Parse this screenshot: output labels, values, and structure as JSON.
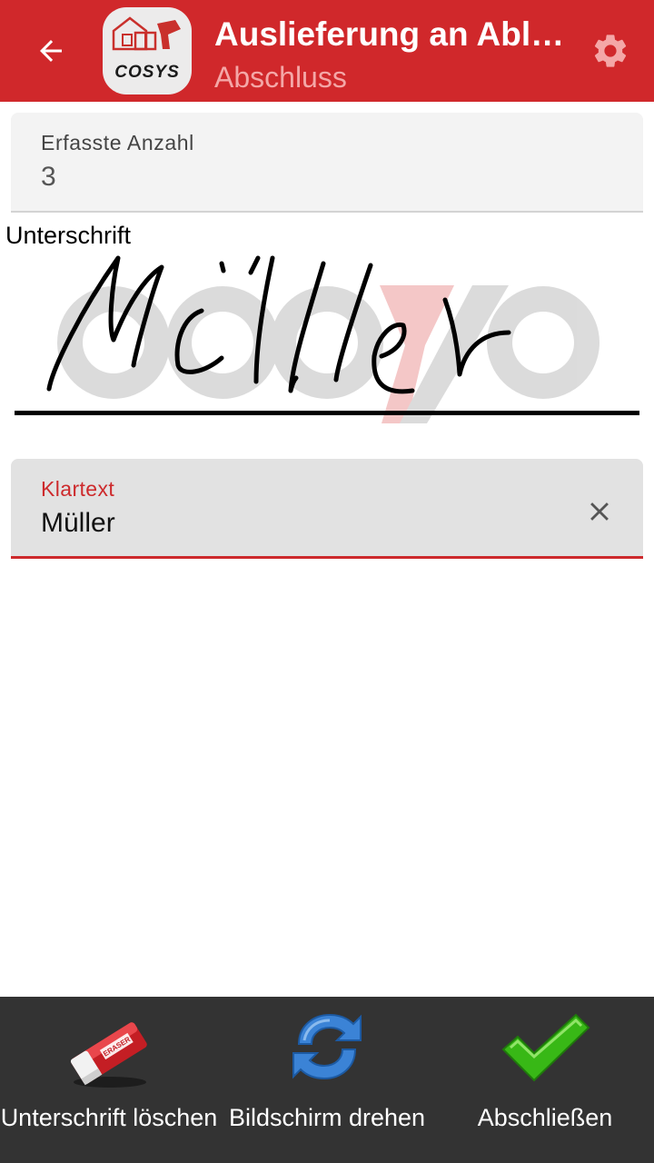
{
  "appbar": {
    "title": "Auslieferung an Ablageort",
    "subtitle": "Abschluss",
    "logo_text": "COSYS",
    "colors": {
      "background": "#d0282b",
      "subtitle": "#f4a7a7"
    }
  },
  "count_field": {
    "label": "Erfasste Anzahl",
    "value": "3"
  },
  "signature": {
    "label": "Unterschrift",
    "handwritten": "Müller"
  },
  "klartext_field": {
    "label": "Klartext",
    "value": "Müller",
    "accent_color": "#cd2a2c"
  },
  "bottom_bar": {
    "buttons": [
      {
        "label": "Unterschrift löschen",
        "icon": "eraser-icon"
      },
      {
        "label": "Bildschirm drehen",
        "icon": "rotate-icon"
      },
      {
        "label": "Abschließen",
        "icon": "checkmark-icon"
      }
    ]
  },
  "icons": {
    "back": "arrow-left-icon",
    "settings": "gear-icon",
    "clear": "close-icon"
  }
}
